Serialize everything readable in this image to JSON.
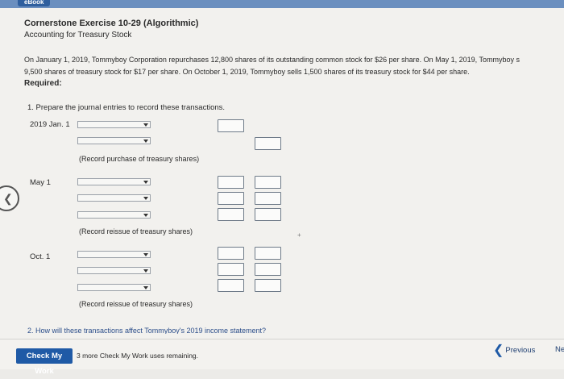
{
  "header": {
    "ebook_label": "eBook"
  },
  "exercise": {
    "title": "Cornerstone Exercise 10-29 (Algorithmic)",
    "subtitle": "Accounting for Treasury Stock",
    "problem_line1": "On January 1, 2019, Tommyboy Corporation repurchases 12,800 shares of its outstanding common stock for $26 per share. On May 1, 2019, Tommyboy s",
    "problem_line2": "9,500 shares of treasury stock for $17 per share. On October 1, 2019, Tommyboy sells 1,500 shares of its treasury stock for $44 per share.",
    "required_label": "Required:",
    "question1": "1.  Prepare the journal entries to record these transactions.",
    "question2": "2.  How will these transactions affect Tommyboy's 2019 income statement?"
  },
  "journal": {
    "entries": [
      {
        "date": "2019 Jan. 1",
        "note": "(Record purchase of treasury shares)"
      },
      {
        "date": "May 1",
        "note": "(Record reissue of treasury shares)"
      },
      {
        "date": "Oct. 1",
        "note": "(Record reissue of treasury shares)"
      }
    ]
  },
  "footer": {
    "check_button": "Check My Work",
    "remaining_text": "3 more Check My Work uses remaining.",
    "previous_label": "Previous",
    "next_label": "Ne"
  },
  "colors": {
    "accent": "#1f5aa6",
    "topbar": "#6b8fbf"
  },
  "icons": {
    "back": "chevron-left-icon",
    "previous": "chevron-left-icon",
    "dropdown": "chevron-down-icon"
  }
}
